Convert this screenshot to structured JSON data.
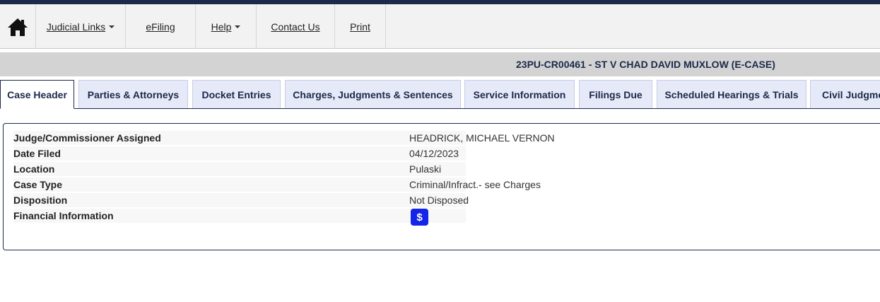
{
  "nav": {
    "home_icon": "home-icon",
    "items": [
      {
        "label": "Judicial Links",
        "dropdown": true
      },
      {
        "label": "eFiling",
        "dropdown": false
      },
      {
        "label": "Help",
        "dropdown": true
      },
      {
        "label": "Contact Us",
        "dropdown": false
      },
      {
        "label": "Print",
        "dropdown": false
      }
    ]
  },
  "case": {
    "title": "23PU-CR00461 - ST V CHAD DAVID MUXLOW (E-CASE)"
  },
  "tabs": [
    {
      "label": "Case Header",
      "active": true
    },
    {
      "label": "Parties & Attorneys",
      "active": false
    },
    {
      "label": "Docket Entries",
      "active": false
    },
    {
      "label": "Charges, Judgments & Sentences",
      "active": false
    },
    {
      "label": "Service Information",
      "active": false
    },
    {
      "label": "Filings Due",
      "active": false
    },
    {
      "label": "Scheduled Hearings & Trials",
      "active": false
    },
    {
      "label": "Civil Judgments",
      "active": false
    }
  ],
  "details": [
    {
      "label": "Judge/Commissioner Assigned",
      "value": "HEADRICK, MICHAEL VERNON"
    },
    {
      "label": "Date Filed",
      "value": "04/12/2023"
    },
    {
      "label": "Location",
      "value": "Pulaski"
    },
    {
      "label": "Case Type",
      "value": "Criminal/Infract.- see Charges"
    },
    {
      "label": "Disposition",
      "value": "Not Disposed"
    },
    {
      "label": "Financial Information",
      "value": ""
    }
  ],
  "financial_button": {
    "symbol": "$",
    "icon": "dollar-icon",
    "color": "#1424e8"
  },
  "colors": {
    "navy": "#1b2a4a",
    "tab_bg": "#e6e9f7",
    "casebar_bg": "#d3d3d3"
  }
}
